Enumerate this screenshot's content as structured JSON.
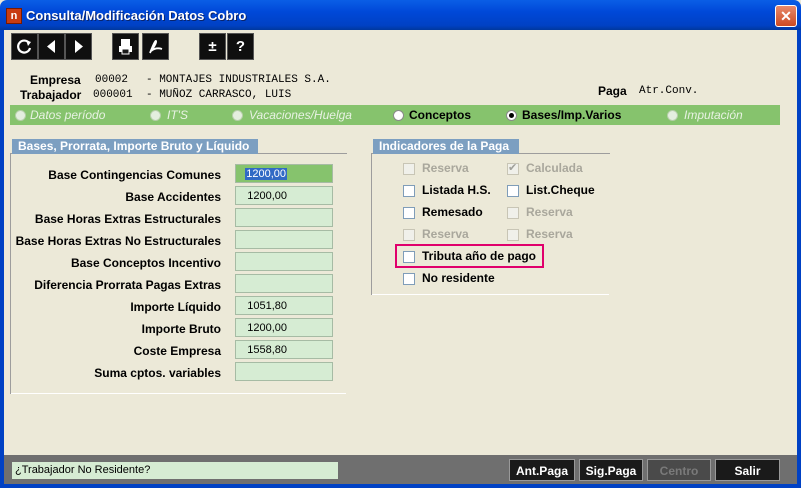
{
  "window": {
    "icon_letter": "n",
    "title": "Consulta/Modificación Datos Cobro",
    "close_label": "✕"
  },
  "toolbar": {
    "refresh_icon": "refresh-icon",
    "prev_icon": "arrow-left-icon",
    "next_icon": "arrow-right-icon",
    "print_icon": "printer-icon",
    "pdf_icon": "pdf-icon",
    "plusminus_label": "±",
    "help_label": "?"
  },
  "header": {
    "empresa_label": "Empresa",
    "empresa_code": "00002",
    "empresa_name": "- MONTAJES INDUSTRIALES S.A.",
    "trabajador_label": "Trabajador",
    "trabajador_code": "000001",
    "trabajador_name": "- MUÑOZ CARRASCO, LUIS",
    "paga_label": "Paga",
    "paga_value": "Atr.Conv."
  },
  "tabs": [
    {
      "label": "Datos período",
      "enabled": false,
      "selected": false
    },
    {
      "label": "IT'S",
      "enabled": false,
      "selected": false
    },
    {
      "label": "Vacaciones/Huelga",
      "enabled": false,
      "selected": false
    },
    {
      "label": "Conceptos",
      "enabled": true,
      "selected": false
    },
    {
      "label": "Bases/Imp.Varios",
      "enabled": true,
      "selected": true
    },
    {
      "label": "Imputación",
      "enabled": false,
      "selected": false
    }
  ],
  "bases": {
    "title": "Bases, Prorrata, Importe Bruto y Líquido",
    "rows": [
      {
        "label": "Base Contingencias Comunes",
        "value": "1200,00"
      },
      {
        "label": "Base Accidentes",
        "value": "1200,00"
      },
      {
        "label": "Base Horas Extras Estructurales",
        "value": ""
      },
      {
        "label": "Base Horas Extras No Estructurales",
        "value": ""
      },
      {
        "label": "Base Conceptos Incentivo",
        "value": ""
      },
      {
        "label": "Diferencia Prorrata Pagas Extras",
        "value": ""
      },
      {
        "label": "Importe Líquido",
        "value": "1051,80"
      },
      {
        "label": "Importe Bruto",
        "value": "1200,00"
      },
      {
        "label": "Coste Empresa",
        "value": "1558,80"
      },
      {
        "label": "Suma cptos. variables",
        "value": ""
      }
    ]
  },
  "indicadores": {
    "title": "Indicadores de la Paga",
    "items": [
      {
        "label": "Reserva",
        "checked": false,
        "enabled": false
      },
      {
        "label": "Calculada",
        "checked": true,
        "enabled": false
      },
      {
        "label": "Listada H.S.",
        "checked": false,
        "enabled": true
      },
      {
        "label": "List.Cheque",
        "checked": false,
        "enabled": true
      },
      {
        "label": "Remesado",
        "checked": false,
        "enabled": true
      },
      {
        "label": "Reserva",
        "checked": false,
        "enabled": false
      },
      {
        "label": "Reserva",
        "checked": false,
        "enabled": false
      },
      {
        "label": "Reserva",
        "checked": false,
        "enabled": false
      },
      {
        "label": "Tributa año de pago",
        "checked": false,
        "enabled": true
      },
      {
        "label": "No residente",
        "checked": false,
        "enabled": true
      }
    ]
  },
  "status": {
    "message": "¿Trabajador No Residente?",
    "buttons": [
      {
        "label": "Ant.Paga",
        "enabled": true
      },
      {
        "label": "Sig.Paga",
        "enabled": true
      },
      {
        "label": "Centro",
        "enabled": false
      },
      {
        "label": "Salir",
        "enabled": true
      }
    ]
  },
  "colors": {
    "title_bar": "#0048d8",
    "tab_bar_green": "#86c36d",
    "field_green": "#d6ecd3",
    "group_title": "#7c9fc1",
    "highlight": "#e0006c"
  }
}
